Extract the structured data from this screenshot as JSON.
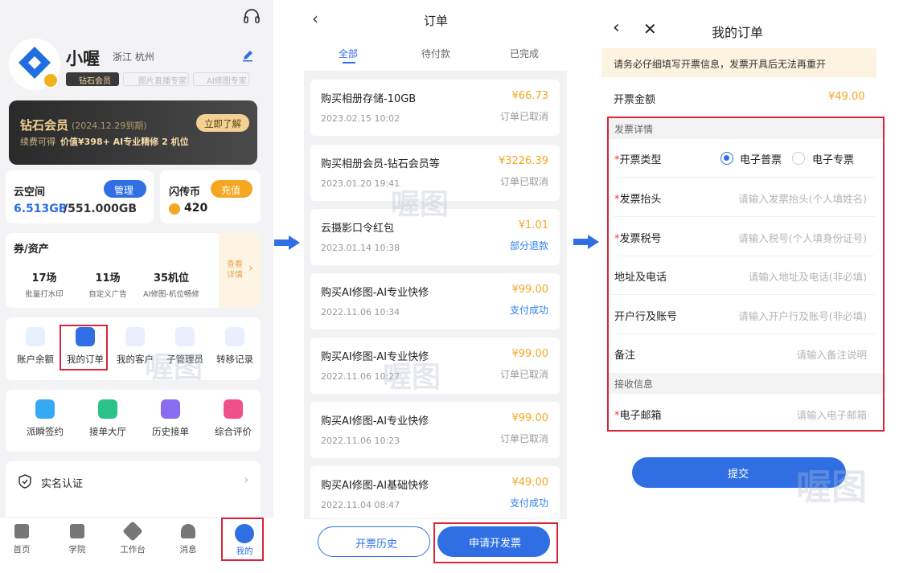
{
  "p1": {
    "user_name": "小喔",
    "location": "浙江 杭州",
    "badges": [
      "钻石会员",
      "图片直播专家",
      "AI修图专家"
    ],
    "vip": {
      "title": "钻石会员",
      "expiry": "(2024.12.29到期)",
      "desc_prefix": "续费可得 ",
      "desc_bold": "价值¥398+ AI专业精修 2 机位",
      "btn": "立即了解"
    },
    "cloud": {
      "title": "云空间",
      "btn": "管理",
      "value_used": "6.513GB",
      "value_total": "/551.000GB"
    },
    "coin": {
      "title": "闪传币",
      "btn": "充值",
      "value": "420"
    },
    "coupons": {
      "title": "券/资产",
      "more": "查看详情",
      "items": [
        {
          "value": "17场",
          "label": "批量打水印"
        },
        {
          "value": "11场",
          "label": "自定义广告"
        },
        {
          "value": "35机位",
          "label": "AI修图-机位畅修"
        }
      ]
    },
    "grid1": [
      "账户余额",
      "我的订单",
      "我的客户",
      "子管理员",
      "转移记录"
    ],
    "grid2": [
      "派瞬签约",
      "接单大厅",
      "历史接单",
      "综合评价"
    ],
    "verify": "实名认证",
    "tabs": [
      "首页",
      "学院",
      "工作台",
      "消息",
      "我的"
    ],
    "watermark": "喔图"
  },
  "p2": {
    "title": "订单",
    "tabs": [
      "全部",
      "待付款",
      "已完成"
    ],
    "orders": [
      {
        "title": "购买相册存储-10GB",
        "amount": "¥66.73",
        "date": "2023.02.15 10:02",
        "status": "订单已取消"
      },
      {
        "title": "购买相册会员-钻石会员等",
        "amount": "¥3226.39",
        "date": "2023.01.20 19:41",
        "status": "订单已取消"
      },
      {
        "title": "云摄影口令红包",
        "amount": "¥1.01",
        "date": "2023.01.14 10:38",
        "status": "部分退款"
      },
      {
        "title": "购买AI修图-AI专业快修",
        "amount": "¥99.00",
        "date": "2022.11.06 10:34",
        "status": "支付成功"
      },
      {
        "title": "购买AI修图-AI专业快修",
        "amount": "¥99.00",
        "date": "2022.11.06 10:27",
        "status": "订单已取消"
      },
      {
        "title": "购买AI修图-AI专业快修",
        "amount": "¥99.00",
        "date": "2022.11.06 10:23",
        "status": "订单已取消"
      },
      {
        "title": "购买AI修图-AI基础快修",
        "amount": "¥49.00",
        "date": "2022.11.04 08:47",
        "status": "支付成功"
      }
    ],
    "btn_history": "开票历史",
    "btn_apply": "申请开发票",
    "watermark": "喔图"
  },
  "p3": {
    "title": "我的订单",
    "notice": "请务必仔细填写开票信息，发票开具后无法再重开",
    "amount_label": "开票金额",
    "amount": "¥49.00",
    "section_detail": "发票详情",
    "type_label": "开票类型",
    "type_opt1": "电子普票",
    "type_opt2": "电子专票",
    "fields": [
      {
        "label": "发票抬头",
        "placeholder": "请输入发票抬头(个人填姓名)",
        "req": "*"
      },
      {
        "label": "发票税号",
        "placeholder": "请输入税号(个人填身份证号)",
        "req": "*"
      },
      {
        "label": "地址及电话",
        "placeholder": "请输入地址及电话(非必填)",
        "req": ""
      },
      {
        "label": "开户行及账号",
        "placeholder": "请输入开户行及账号(非必填)",
        "req": ""
      },
      {
        "label": "备注",
        "placeholder": "请输入备注说明",
        "req": ""
      }
    ],
    "section_recv": "接收信息",
    "email_label": "电子邮箱",
    "email_placeholder": "请输入电子邮箱",
    "submit": "提交",
    "watermark": "喔图",
    "req_mark": "*"
  }
}
